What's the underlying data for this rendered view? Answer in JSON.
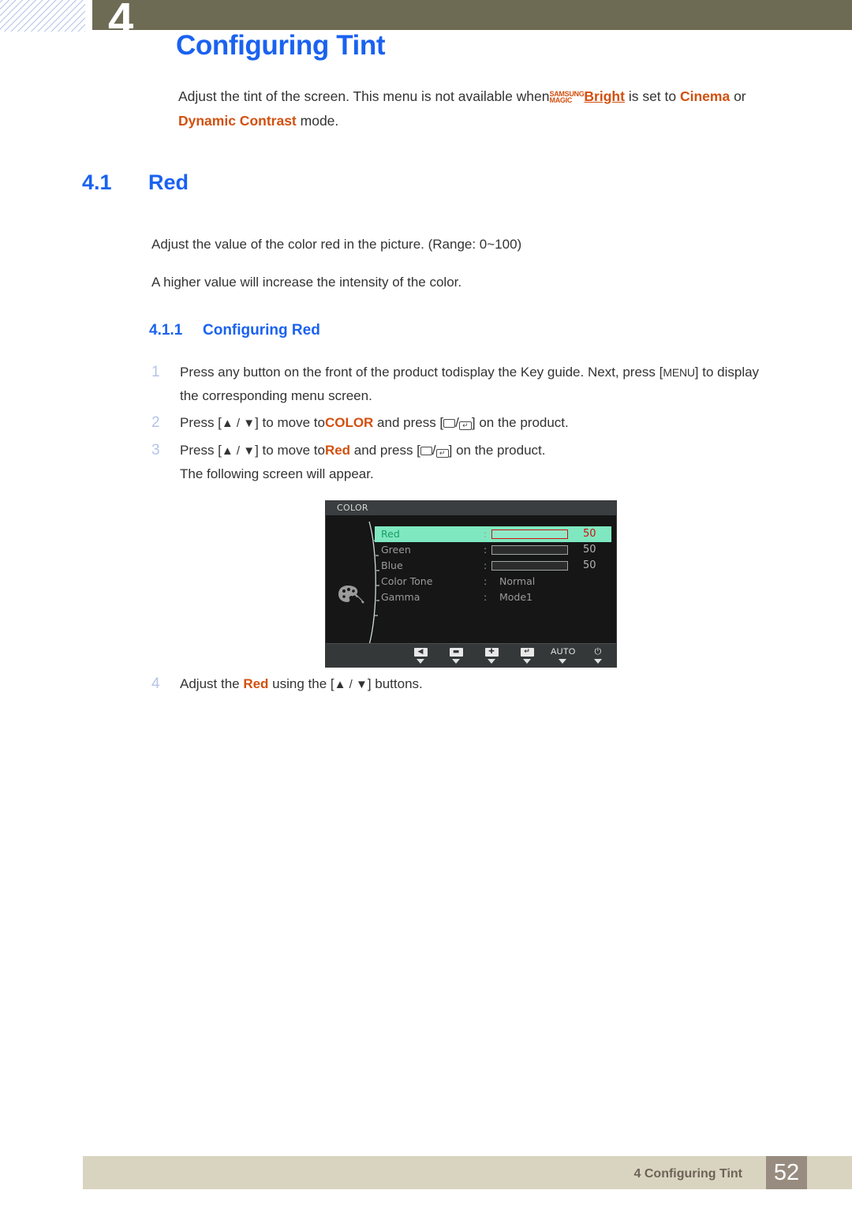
{
  "header": {
    "chapter_number": "4",
    "page_title": "Configuring Tint"
  },
  "intro": {
    "text_before": "Adjust the tint of the screen. This menu is not available when",
    "magic_top": "SAMSUNG",
    "magic_bottom": "MAGIC",
    "bright": "Bright",
    "text_mid": " is set to ",
    "cinema": "Cinema",
    "text_or": " or ",
    "dynamic_contrast": "Dynamic Contrast",
    "text_end": " mode."
  },
  "section": {
    "number": "4.1",
    "title": "Red",
    "paragraph_1": "Adjust the value of the color red in the picture. (Range: 0~100)",
    "paragraph_2": "A higher value will increase the intensity of the color."
  },
  "subsection": {
    "number": "4.1.1",
    "title": "Configuring Red"
  },
  "steps": [
    {
      "num": "1",
      "line1_a": "Press any button on the front of the product to",
      "line1_b": "display the Key guide. Ne",
      "line1_c": "xt, press [",
      "menu_key": "MENU",
      "line1_d": "] to display",
      "line2": "the corresponding menu screen."
    },
    {
      "num": "2",
      "a": "Press [",
      "arrows": "▲ / ▼",
      "b": "] to move to",
      "target": "COLOR",
      "c": " and press [",
      "d": "/",
      "e": "] on the product."
    },
    {
      "num": "3",
      "a": "Press [",
      "arrows": "▲ / ▼",
      "b": "] to move to",
      "target": "Red",
      "c": " and press [",
      "d": "/",
      "e": "] on the product."
    }
  ],
  "step3_follow": "The following screen will appear.",
  "step4": {
    "num": "4",
    "a": "Adjust the ",
    "target": "Red",
    "b": " using the [",
    "arrows": "▲ / ▼",
    "c": "] buttons."
  },
  "osd": {
    "title": "COLOR",
    "rows": [
      {
        "label": "Red",
        "colon": ":",
        "type": "bar",
        "value": "50",
        "fill_percent": 50,
        "highlighted": true
      },
      {
        "label": "Green",
        "colon": ":",
        "type": "bar",
        "value": "50",
        "fill_percent": 50,
        "highlighted": false
      },
      {
        "label": "Blue",
        "colon": ":",
        "type": "bar",
        "value": "50",
        "fill_percent": 50,
        "highlighted": false
      },
      {
        "label": "Color Tone",
        "colon": ":",
        "type": "text",
        "value": "Normal",
        "highlighted": false
      },
      {
        "label": "Gamma",
        "colon": ":",
        "type": "text",
        "value": "Mode1",
        "highlighted": false
      }
    ],
    "keys": [
      {
        "name": "back-icon",
        "glyph": "◀",
        "kind": "box"
      },
      {
        "name": "minus-icon",
        "glyph": "▬",
        "kind": "box"
      },
      {
        "name": "plus-icon",
        "glyph": "✚",
        "kind": "box"
      },
      {
        "name": "enter-icon",
        "glyph": "↵",
        "kind": "box"
      },
      {
        "name": "auto-label",
        "glyph": "AUTO",
        "kind": "text"
      },
      {
        "name": "power-icon",
        "glyph": "⏻",
        "kind": "text"
      }
    ]
  },
  "footer": {
    "text": "4 Configuring Tint",
    "page_number": "52"
  },
  "colors": {
    "accent_blue": "#1a62f0",
    "accent_orange": "#d2500f",
    "header_olive": "#6e6b55",
    "footer_beige": "#d9d4c0",
    "page_box": "#988c80",
    "osd_highlight": "#7fe8c0",
    "osd_red": "#e00000"
  }
}
